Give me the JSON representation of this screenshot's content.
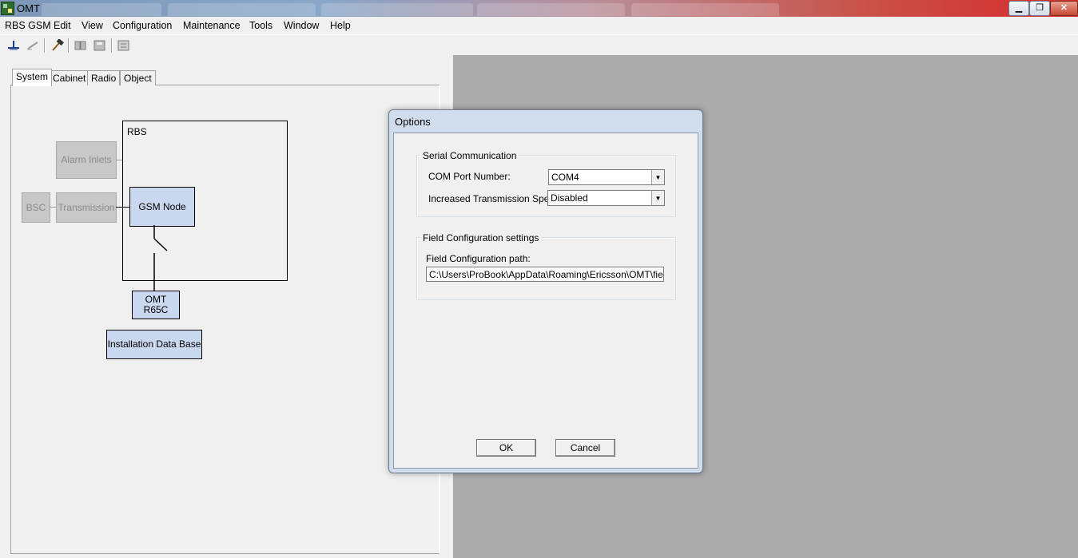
{
  "window": {
    "title": "OMT",
    "minimize": "▁",
    "maximize": "❐",
    "close": "✕"
  },
  "menubar": [
    "RBS GSM",
    "Edit",
    "View",
    "Configuration",
    "Maintenance",
    "Tools",
    "Window",
    "Help"
  ],
  "toolbar": {
    "icons": [
      "connect-icon",
      "disconnect-icon",
      "hammer-icon",
      "book-icon",
      "save-icon",
      "compare-icon"
    ]
  },
  "tabs": [
    "System",
    "Cabinet",
    "Radio",
    "Object"
  ],
  "diagram": {
    "rbs_label": "RBS",
    "alarm_inlets": "Alarm Inlets",
    "bsc": "BSC",
    "transmission": "Transmission",
    "gsm_node": "GSM Node",
    "omt": "OMT\nR65C",
    "installation_db": "Installation Data Base"
  },
  "dialog": {
    "title": "Options",
    "serial": {
      "legend": "Serial Communication",
      "com_port_label": "COM Port Number:",
      "com_port_value": "COM4",
      "speed_label": "Increased Transmission Speed:",
      "speed_value": "Disabled"
    },
    "field": {
      "legend": "Field Configuration settings",
      "path_label": "Field Configuration path:",
      "path_value": "C:\\Users\\ProBook\\AppData\\Roaming\\Ericsson\\OMT\\field\\"
    },
    "ok": "OK",
    "cancel": "Cancel"
  }
}
